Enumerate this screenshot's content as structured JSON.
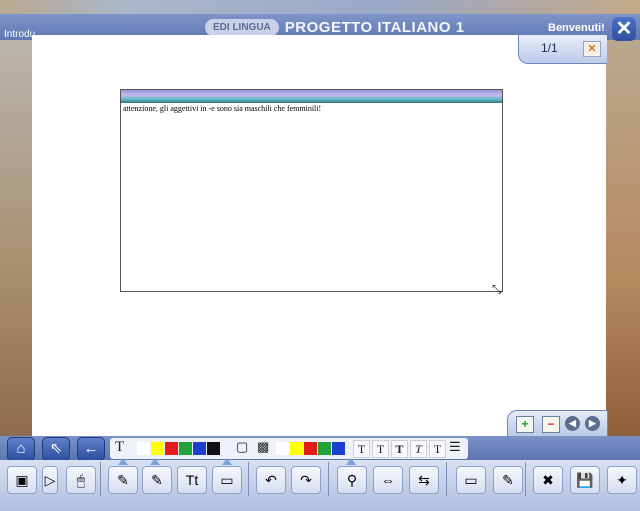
{
  "header": {
    "intro_label": "Introdu",
    "brand_logo": "EDI LINGUA",
    "app_title": "PROGETTO ITALIANO 1",
    "welcome": "Benvenuti!",
    "close_glyph": "✕"
  },
  "pager": {
    "current": "1/1",
    "close_glyph": "✕"
  },
  "note": {
    "text": "attenzione, gli aggettivi in -e sono sia maschili che femminili!"
  },
  "page_controls": {
    "add": "+",
    "remove": "−",
    "prev": "◀",
    "next": "▶"
  },
  "nav": {
    "home": "⌂",
    "up": "⇖",
    "back": "←"
  },
  "text_toolbar": {
    "text_glyph": "T",
    "colors_a": [
      "#ffffff",
      "#ffff00",
      "#e31b1b",
      "#22a43a",
      "#1a3fd1",
      "#111111"
    ],
    "colors_b": [
      "#ffffff",
      "#ffff00",
      "#e31b1b",
      "#22a43a",
      "#1a3fd1"
    ],
    "format_glyphs": [
      "T",
      "T",
      "T",
      "T",
      "T"
    ]
  },
  "tools": {
    "icons": [
      "screen-icon",
      "pointer-icon",
      "mouse-icon",
      "pencil-icon",
      "highlighter-icon",
      "text-tool-icon",
      "eraser-icon",
      "undo-icon",
      "redo-icon",
      "magnifier-icon",
      "expand-icon",
      "shrink-icon",
      "clear-icon",
      "edit-icon",
      "delete-icon",
      "save-icon",
      "effects-icon"
    ],
    "glyphs": [
      "▣",
      "▷",
      "🖱",
      "✎",
      "✎",
      "Tt",
      "▭",
      "↶",
      "↷",
      "⚲",
      "⇔",
      "⇆",
      "▭",
      "✎",
      "✖",
      "💾",
      "✦"
    ]
  }
}
